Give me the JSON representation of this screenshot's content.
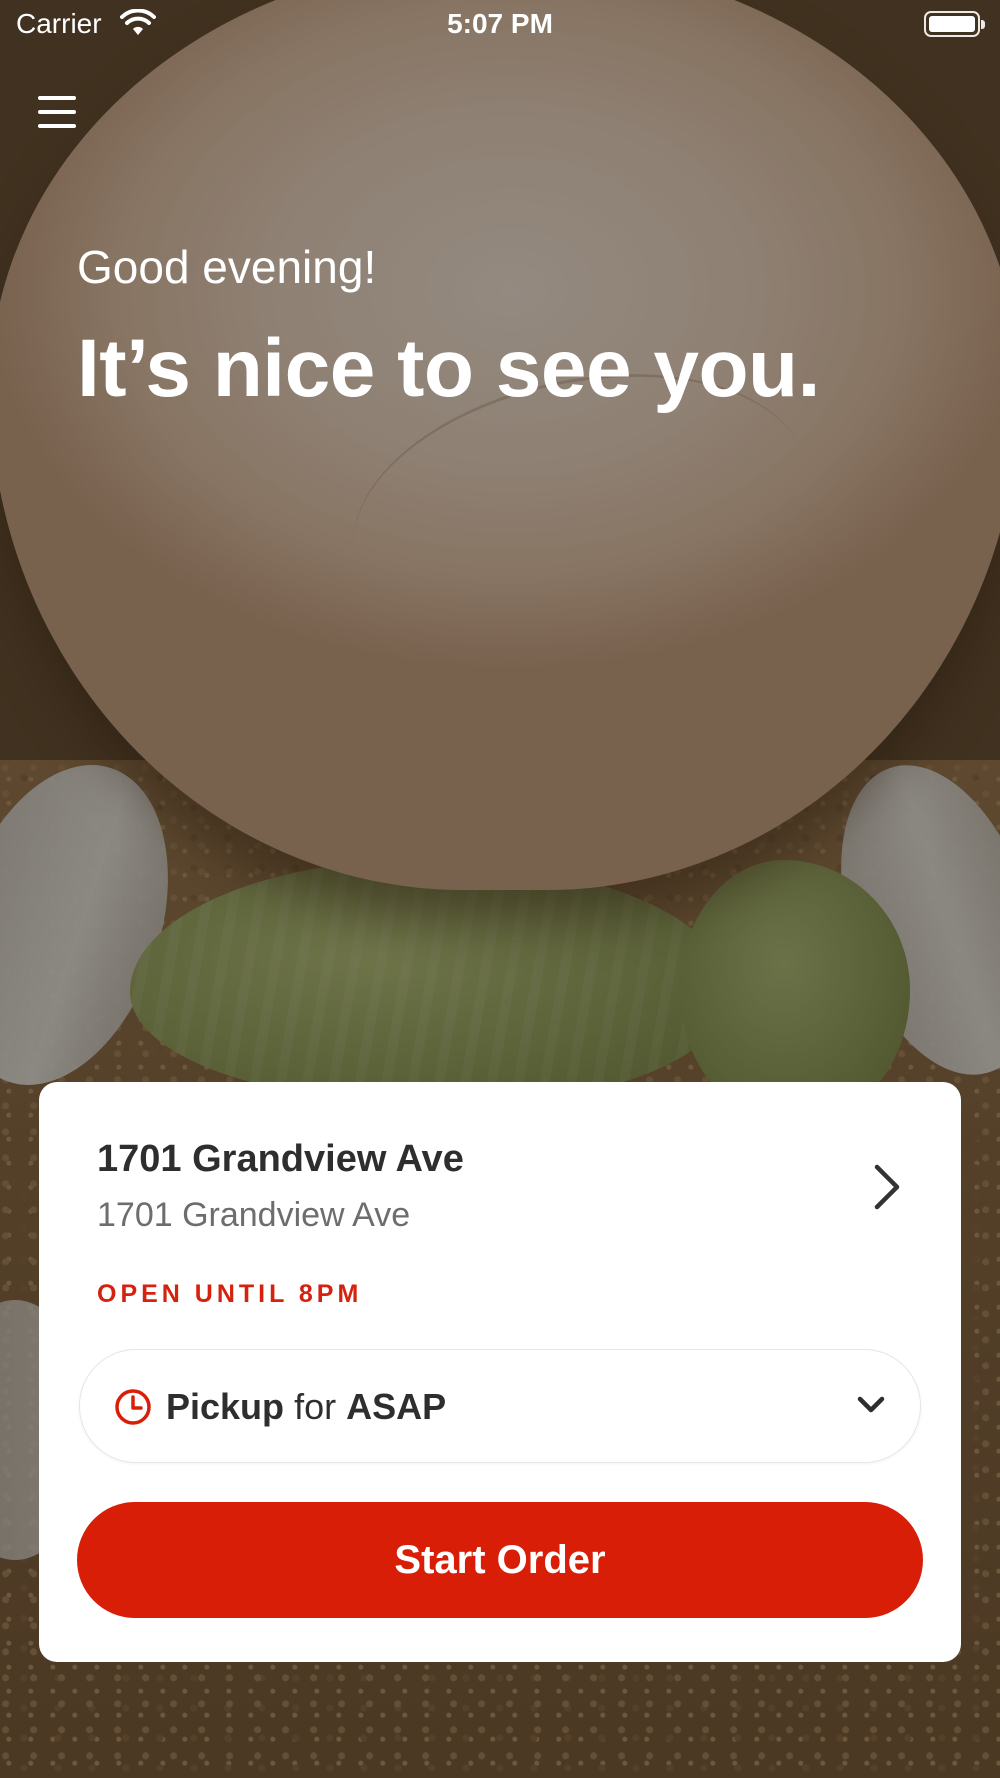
{
  "status_bar": {
    "carrier": "Carrier",
    "time": "5:07 PM",
    "wifi_icon": "wifi-icon",
    "battery_icon": "battery-icon"
  },
  "menu": {
    "icon": "hamburger-menu-icon"
  },
  "hero": {
    "greeting": "Good evening!",
    "headline": "It’s nice to see you."
  },
  "location": {
    "name": "1701 Grandview Ave",
    "address": "1701 Grandview Ave",
    "hours": "OPEN UNTIL 8PM",
    "chevron_icon": "chevron-right-icon"
  },
  "order_type": {
    "mode": "Pickup",
    "connector": "for",
    "time": "ASAP",
    "icon": "clock-icon",
    "dropdown_icon": "chevron-down-icon"
  },
  "actions": {
    "start_order_label": "Start Order"
  },
  "colors": {
    "accent": "#d91e07",
    "hours_text": "#d4220f",
    "card_background": "#ffffff"
  }
}
